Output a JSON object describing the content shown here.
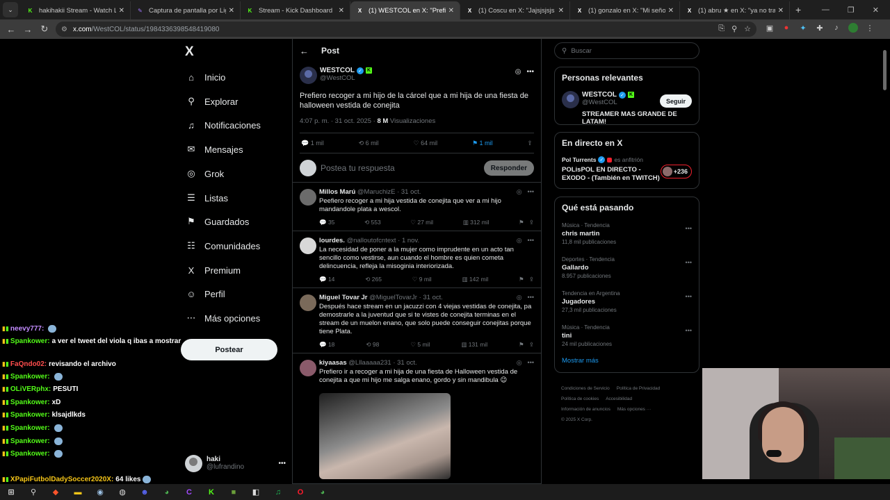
{
  "browser": {
    "tabs": [
      {
        "title": "hakihakii Stream - Watch Live o",
        "fav": "K",
        "fav_color": "#53fc18",
        "active": false
      },
      {
        "title": "Captura de pantalla por Lightsh",
        "fav": "✎",
        "fav_color": "#a277ff",
        "active": false
      },
      {
        "title": "Stream - Kick Dashboard",
        "fav": "K",
        "fav_color": "#53fc18",
        "active": false
      },
      {
        "title": "(1) WESTCOL en X: \"Prefiero rec",
        "fav": "X",
        "fav_color": "#ffffff",
        "active": true
      },
      {
        "title": "(1) Coscu en X: \"Jajsjsjsjs lo pec",
        "fav": "X",
        "fav_color": "#ffffff",
        "active": false
      },
      {
        "title": "(1) gonzalo en X: \"Mi señora se",
        "fav": "X",
        "fav_color": "#ffffff",
        "active": false
      },
      {
        "title": "(1) abru ★ en X: \"ya no trabajo",
        "fav": "X",
        "fav_color": "#ffffff",
        "active": false
      }
    ],
    "new_tab": "+",
    "url_host": "x.com",
    "url_path": "/WestCOL/status/1984336398548419080"
  },
  "nav": {
    "items": [
      {
        "label": "Inicio",
        "icon": "home-icon",
        "glyph": "⌂"
      },
      {
        "label": "Explorar",
        "icon": "search-icon",
        "glyph": "⚲"
      },
      {
        "label": "Notificaciones",
        "icon": "bell-icon",
        "glyph": "♫"
      },
      {
        "label": "Mensajes",
        "icon": "mail-icon",
        "glyph": "✉"
      },
      {
        "label": "Grok",
        "icon": "grok-icon",
        "glyph": "◎"
      },
      {
        "label": "Listas",
        "icon": "list-icon",
        "glyph": "☰"
      },
      {
        "label": "Guardados",
        "icon": "bookmark-icon",
        "glyph": "⚑"
      },
      {
        "label": "Comunidades",
        "icon": "communities-icon",
        "glyph": "☷"
      },
      {
        "label": "Premium",
        "icon": "x-logo-icon",
        "glyph": "X"
      },
      {
        "label": "Perfil",
        "icon": "profile-icon",
        "glyph": "☺"
      },
      {
        "label": "Más opciones",
        "icon": "more-icon",
        "glyph": "⋯"
      }
    ],
    "post_label": "Postear",
    "account_name": "haki",
    "account_handle": "@lufrandino"
  },
  "chat": [
    {
      "user": "neevy777:",
      "color": "#c38cff",
      "msg": "",
      "emote": true
    },
    {
      "user": "Spankower:",
      "color": "#53fc18",
      "msg": "a ver el tweet del viola q ibas a mostrar",
      "emote": false
    },
    {
      "user": "FaQndo02:",
      "color": "#ff4d4d",
      "msg": "revisando el archivo",
      "emote": false
    },
    {
      "user": "Spankower:",
      "color": "#53fc18",
      "msg": "",
      "emote": true
    },
    {
      "user": "OLiVERphx:",
      "color": "#53fc18",
      "msg": "PESUTI",
      "emote": false
    },
    {
      "user": "Spankower:",
      "color": "#53fc18",
      "msg": "xD",
      "emote": false
    },
    {
      "user": "Spankower:",
      "color": "#53fc18",
      "msg": "klsajdlkds",
      "emote": false
    },
    {
      "user": "Spankower:",
      "color": "#53fc18",
      "msg": "",
      "emote": true
    },
    {
      "user": "Spankower:",
      "color": "#53fc18",
      "msg": "",
      "emote": true
    },
    {
      "user": "Spankower:",
      "color": "#53fc18",
      "msg": "",
      "emote": true
    },
    {
      "user": "XPapiFutbolDadySoccer2020X:",
      "color": "#f5c518",
      "msg": "64 likes",
      "emote": true
    }
  ],
  "main": {
    "title": "Post",
    "post": {
      "author": "WESTCOL",
      "handle": "@WestCOL",
      "text": "Prefiero recoger a mi hijo de la cárcel que a mi hija de una fiesta de halloween vestida de conejita",
      "time": "4:07 p. m. · 31 oct. 2025 ·",
      "views": "8 M",
      "views_label": "Visualizaciones",
      "replies": "1 mil",
      "reposts": "6 mil",
      "likes": "64 mil",
      "bookmarks": "1 mil"
    },
    "reply_placeholder": "Postea tu respuesta",
    "reply_button": "Responder",
    "replies": [
      {
        "name": "Millos Marú",
        "handle": "@MaruchizE · 31 oct.",
        "text": "Peefiero recoger a mi hija vestida de conejita que ver a mi hijo mandandole plata a wescol.",
        "c": "35",
        "r": "553",
        "l": "27 mil",
        "v": "312 mil",
        "avatar": "#6b6b6b",
        "image": false
      },
      {
        "name": "lourdes.",
        "handle": "@nalloutofcntext · 1 nov.",
        "text": "La necesidad de poner a la mujer como imprudente en un acto tan sencillo como vestirse, aun cuando el hombre es quien cometa delincuencia, refleja la misoginia interiorizada.",
        "c": "14",
        "r": "265",
        "l": "9 mil",
        "v": "142 mil",
        "avatar": "#d8d8d8",
        "image": false
      },
      {
        "name": "Miguel Tovar Jr",
        "handle": "@MiguelTovarJr · 31 oct.",
        "text": "Después hace stream en un jacuzzi con 4 viejas vestidas de conejita, pa demostrarle a la juventud que si te vistes de conejita terminas en el stream de un muelon enano, que solo puede conseguir conejitas porque tiene Plata.",
        "c": "18",
        "r": "98",
        "l": "5 mil",
        "v": "131 mil",
        "avatar": "#7a6a5a",
        "image": false
      },
      {
        "name": "kiyaasas",
        "handle": "@Lllaaaaa231 · 31 oct.",
        "text": "Prefiero ir a recoger a mi hija de una fiesta de Halloween vestida de conejita a que mi hijo me salga enano, gordo y sin mandibula 😉",
        "c": "",
        "r": "",
        "l": "",
        "v": "",
        "avatar": "#8a5a6a",
        "image": true
      }
    ]
  },
  "right": {
    "search_placeholder": "Buscar",
    "relevant_title": "Personas relevantes",
    "rel_name": "WESTCOL",
    "rel_handle": "@WestCOL",
    "rel_bio": "STREAMER MAS GRANDE DE LATAM!",
    "follow_label": "Seguir",
    "live_title": "En directo en X",
    "live_host": "Pol Turrents",
    "live_host_suffix": "es anfitrión",
    "live_text": "POLisPOL EN DIRECTO - EXODO - (También en TWITCH)",
    "live_count": "+236",
    "trends_title": "Qué está pasando",
    "trends": [
      {
        "cat": "Música · Tendencia",
        "name": "chris martin",
        "posts": "11,8 mil publicaciones"
      },
      {
        "cat": "Deportes · Tendencia",
        "name": "Gallardo",
        "posts": "8.957 publicaciones"
      },
      {
        "cat": "Tendencia en Argentina",
        "name": "Jugadores",
        "posts": "27,3 mil publicaciones"
      },
      {
        "cat": "Música · Tendencia",
        "name": "tini",
        "posts": "24 mil publicaciones"
      }
    ],
    "show_more": "Mostrar más",
    "footer": [
      "Condiciones de Servicio",
      "Política de Privacidad",
      "Política de cookies",
      "Accesibilidad",
      "Información de anuncios",
      "Más opciones ···",
      "© 2025 X Corp."
    ]
  },
  "colors": {
    "accent": "#1d9bf0",
    "kick": "#53fc18",
    "live": "#f4212e"
  }
}
